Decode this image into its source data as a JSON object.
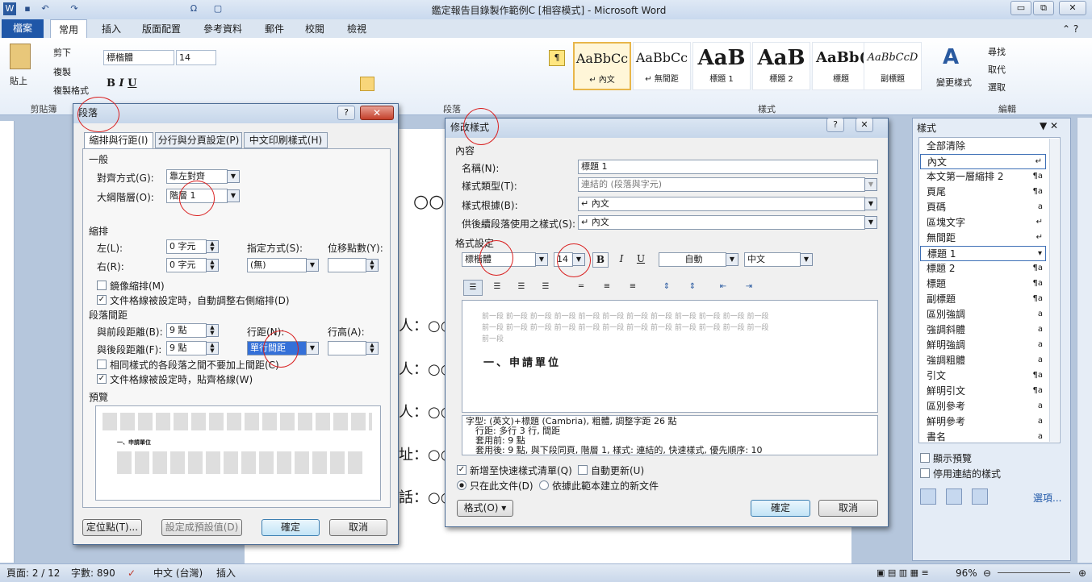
{
  "app": {
    "title": "鑑定報告目錄製作範例C [相容模式] - Microsoft Word",
    "qat": {
      "save": "▪",
      "undo": "↶",
      "redo": "↷",
      "omega": "Ω",
      "page": "▢"
    },
    "win_buttons": {
      "min": "▭",
      "restore": "⧉",
      "close": "✕"
    }
  },
  "ribbon_tabs": [
    {
      "label": "檔案"
    },
    {
      "label": "常用"
    },
    {
      "label": "插入"
    },
    {
      "label": "版面配置"
    },
    {
      "label": "參考資料"
    },
    {
      "label": "郵件"
    },
    {
      "label": "校閱"
    },
    {
      "label": "檢視"
    }
  ],
  "ribbon": {
    "paste": "貼上",
    "cut": "剪下",
    "copy": "複製",
    "format_painter": "複製格式",
    "clipboard": "剪貼簿",
    "font_name": "標楷體",
    "font_size": "14",
    "paragraph_group": "段落",
    "styles_group": "樣式",
    "edit_group": "編輯",
    "find": "尋找",
    "replace": "取代",
    "select": "選取",
    "change_styles": "變更樣式",
    "styles": [
      {
        "preview": "AaBbCc",
        "name": "↵ 內文"
      },
      {
        "preview": "AaBbCc",
        "name": "↵ 無間距"
      },
      {
        "preview": "AaB",
        "name": "標題 1"
      },
      {
        "preview": "AaB",
        "name": "標題 2"
      },
      {
        "preview": "AaBb(",
        "name": "標題"
      },
      {
        "preview": "AaBbCcD",
        "name": "副標題"
      }
    ]
  },
  "document": {
    "lines": [
      "○○",
      "人：○○",
      "人：○○",
      "人：○○",
      "址：○○",
      "話：○○"
    ]
  },
  "paragraph_dialog": {
    "title": "段落",
    "tabs": [
      "縮排與行距(I)",
      "分行與分頁設定(P)",
      "中文印刷樣式(H)"
    ],
    "general": "一般",
    "alignment_label": "對齊方式(G):",
    "alignment_value": "靠左對齊",
    "outline_label": "大綱階層(O):",
    "outline_value": "階層 1",
    "indent": "縮排",
    "left_label": "左(L):",
    "left_value": "0 字元",
    "right_label": "右(R):",
    "right_value": "0 字元",
    "special_label": "指定方式(S):",
    "special_value": "(無)",
    "by_label": "位移點數(Y):",
    "mirror": "鏡像縮排(M)",
    "auto_right": "文件格線被設定時，自動調整右側縮排(D)",
    "spacing": "段落間距",
    "before_label": "與前段距離(B):",
    "before_value": "9 點",
    "after_label": "與後段距離(F):",
    "after_value": "9 點",
    "line_label": "行距(N):",
    "line_value": "單行間距",
    "at_label": "行高(A):",
    "no_space": "相同樣式的各段落之間不要加上間距(C)",
    "snap_grid": "文件格線被設定時，貼齊格線(W)",
    "preview": "預覽",
    "preview_text": "一、申請單位",
    "tabs_btn": "定位點(T)...",
    "default_btn": "設定成預設值(D)",
    "ok": "確定",
    "cancel": "取消"
  },
  "modify_dialog": {
    "title": "修改樣式",
    "properties": "內容",
    "name_label": "名稱(N):",
    "name_value": "標題 1",
    "type_label": "樣式類型(T):",
    "type_value": "連結的 (段落與字元)",
    "based_label": "樣式根據(B):",
    "based_value": "↵ 內文",
    "next_label": "供後續段落使用之樣式(S):",
    "next_value": "↵ 內文",
    "format": "格式設定",
    "font": "標楷體",
    "size": "14",
    "color": "自動",
    "lang": "中文",
    "prev_para": "前一段 前一段 前一段 前一段 前一段 前一段 前一段 前一段 前一段 前一段 前一段 前一段",
    "prev_para_tail": "前一段",
    "sample": "一、申請單位",
    "description_lines": [
      "字型: (英文)+標題 (Cambria), 粗體, 調整字距 26 點",
      "行距: 多行 3 行, 間距",
      "套用前: 9 點",
      "套用後: 9 點, 與下段同頁, 階層 1, 樣式: 連結的, 快速樣式, 優先順序: 10"
    ],
    "add_quick": "新增至快速樣式清單(Q)",
    "auto_update": "自動更新(U)",
    "only_doc": "只在此文件(D)",
    "new_docs": "依據此範本建立的新文件",
    "format_btn": "格式(O)",
    "ok": "確定",
    "cancel": "取消"
  },
  "styles_pane": {
    "title": "樣式",
    "items": [
      {
        "name": "全部清除",
        "icon": ""
      },
      {
        "name": "內文",
        "icon": "↵"
      },
      {
        "name": "本文第一層縮排 2",
        "icon": "¶a"
      },
      {
        "name": "頁尾",
        "icon": "¶a"
      },
      {
        "name": "頁碼",
        "icon": "a"
      },
      {
        "name": "區塊文字",
        "icon": "↵"
      },
      {
        "name": "無間距",
        "icon": "↵"
      },
      {
        "name": "標題 1",
        "icon": "▾"
      },
      {
        "name": "標題 2",
        "icon": "¶a"
      },
      {
        "name": "標題",
        "icon": "¶a"
      },
      {
        "name": "副標題",
        "icon": "¶a"
      },
      {
        "name": "區別強調",
        "icon": "a"
      },
      {
        "name": "強調斜體",
        "icon": "a"
      },
      {
        "name": "鮮明強調",
        "icon": "a"
      },
      {
        "name": "強調粗體",
        "icon": "a"
      },
      {
        "name": "引文",
        "icon": "¶a"
      },
      {
        "name": "鮮明引文",
        "icon": "¶a"
      },
      {
        "name": "區別參考",
        "icon": "a"
      },
      {
        "name": "鮮明參考",
        "icon": "a"
      },
      {
        "name": "書名",
        "icon": "a"
      }
    ],
    "show_preview": "顯示預覽",
    "disable_linked": "停用連結的樣式",
    "options": "選項..."
  },
  "status": {
    "page": "頁面: 2 / 12",
    "words": "字數: 890",
    "lang": "中文 (台灣)",
    "mode": "插入",
    "zoom": "96%"
  }
}
